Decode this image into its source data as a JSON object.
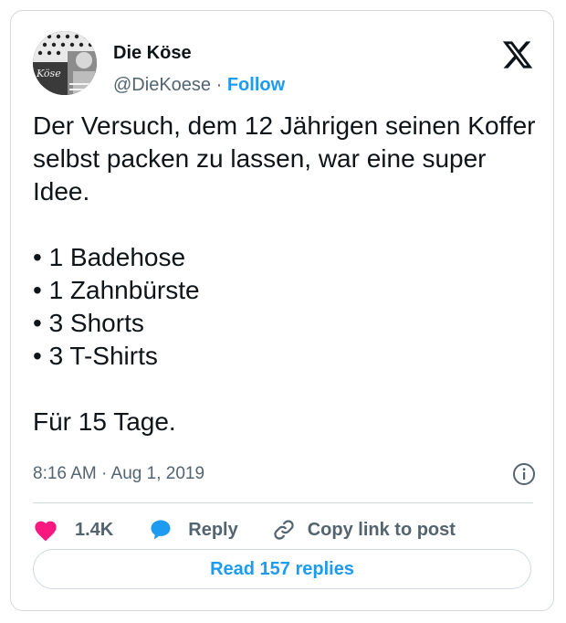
{
  "author": {
    "name": "Die Köse",
    "handle": "@DieKoese",
    "separator": "·",
    "follow_label": "Follow"
  },
  "tweet": {
    "text": "Der Versuch, dem 12 Jährigen seinen Koffer selbst packen zu lassen, war eine super Idee.\n\n• 1 Badehose\n• 1 Zahnbürste\n• 3 Shorts\n• 3 T-Shirts\n\nFür 15 Tage.",
    "timestamp": "8:16 AM · Aug 1, 2019"
  },
  "actions": {
    "likes": "1.4K",
    "reply_label": "Reply",
    "copy_label": "Copy link to post"
  },
  "read_replies_label": "Read 157 replies",
  "colors": {
    "like": "#f91880",
    "reply": "#1d9bf0",
    "link": "#1d9bf0",
    "secondary_text": "#536471"
  },
  "icons": [
    "x-logo-icon",
    "info-icon",
    "heart-icon",
    "reply-bubble-icon",
    "link-icon"
  ]
}
